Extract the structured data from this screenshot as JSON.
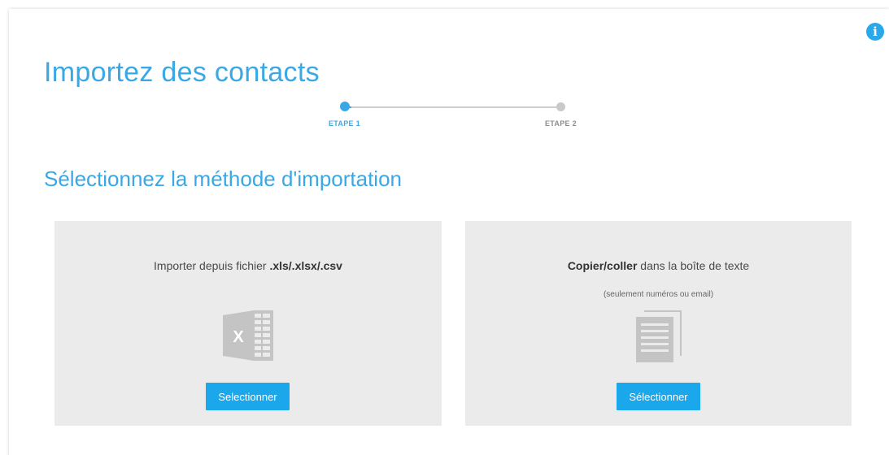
{
  "header": {
    "title": "Importez des contacts",
    "info_icon_glyph": "i"
  },
  "stepper": {
    "steps": [
      {
        "label": "ETAPE 1",
        "state": "active"
      },
      {
        "label": "ETAPE 2",
        "state": "inactive"
      }
    ],
    "active_color": "#39a8e5",
    "inactive_color": "#c9c9c9"
  },
  "section": {
    "title": "Sélectionnez la méthode d'importation"
  },
  "cards": {
    "file": {
      "title_prefix": "Importer depuis fichier ",
      "title_bold": ".xls/.xlsx/.csv",
      "icon": "excel-file-icon",
      "icon_letter": "X",
      "button_label": "Selectionner"
    },
    "paste": {
      "title_bold": "Copier/coller",
      "title_suffix": " dans la boîte de texte",
      "subtitle": "(seulement numéros ou email)",
      "icon": "text-document-icon",
      "button_label": "Sélectionner"
    }
  },
  "colors": {
    "accent": "#39a8e5",
    "button": "#1aa7ec",
    "card_background": "#ebebeb",
    "icon_gray": "#c4c4c4"
  }
}
